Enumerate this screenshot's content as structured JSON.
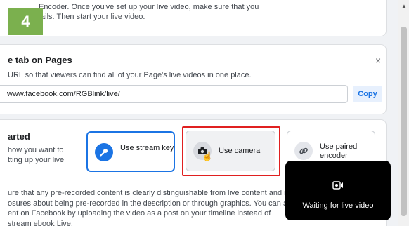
{
  "step_badge": "4",
  "top_card": {
    "text_line1": "Encoder. Once you've set up your live video, make sure that you",
    "text_line2": "tails. Then start your live video."
  },
  "live_tab": {
    "title": "e tab on Pages",
    "close": "×",
    "description": "URL so that viewers can find all of your Page's live videos in one place.",
    "url": "www.facebook.com/RGBlink/live/",
    "copy_label": "Copy"
  },
  "get_started": {
    "title": "arted",
    "description": "how you want to tting up your live",
    "options": [
      {
        "label": "Use stream key",
        "icon": "key-icon"
      },
      {
        "label": "Use camera",
        "icon": "camera-icon"
      },
      {
        "label": "Use paired encoder",
        "icon": "link-icon"
      }
    ],
    "notice": "ure that any pre-recorded content is clearly distinguishable from live content and inc osures about being pre-recorded in the description or through graphics. You can als ent on Facebook by uploading the video as a post on your timeline instead of stream ebook Live."
  },
  "waiting_panel": {
    "text": "Waiting for live video",
    "icon": "live-camera-icon"
  },
  "colors": {
    "accent": "#1b74e4",
    "highlight": "#e02020",
    "badge": "#7bb04e"
  }
}
